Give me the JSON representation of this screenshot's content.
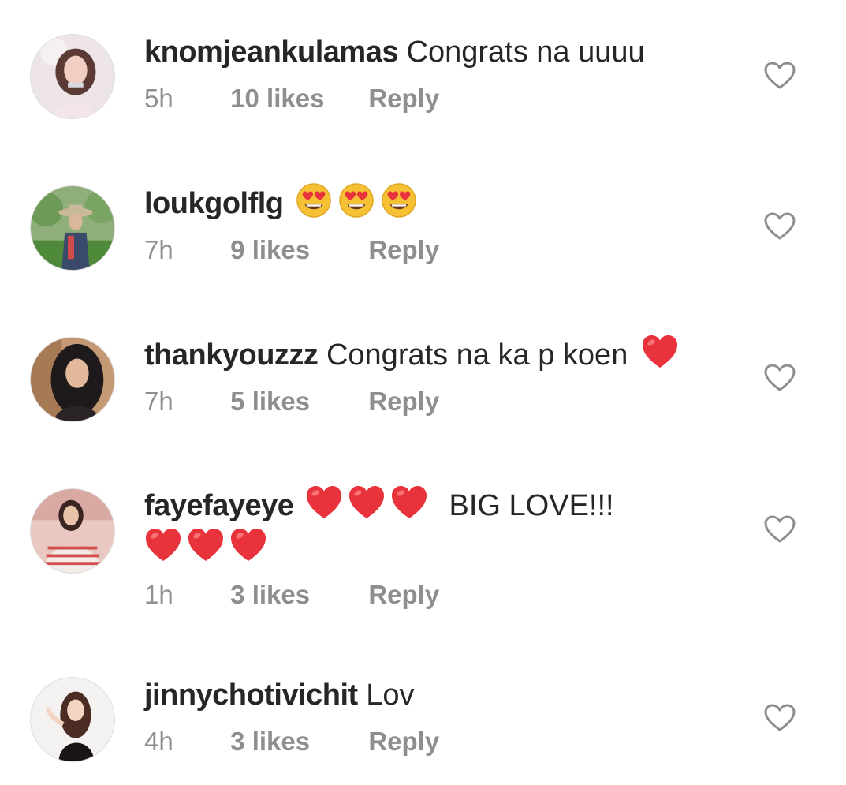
{
  "colors": {
    "text": "#262626",
    "muted": "#8e8e8e",
    "heart_red": "#e8323c",
    "emoji_yellow": "#f5c033"
  },
  "comments": [
    {
      "username": "knomjeankulamas",
      "text": "Congrats na uuuu",
      "time": "5h",
      "likes": "10 likes",
      "reply": "Reply",
      "like_icon": "heart-outline-icon"
    },
    {
      "username": "loukgolflg",
      "emoji": [
        "heart-eyes-emoji",
        "heart-eyes-emoji",
        "heart-eyes-emoji"
      ],
      "time": "7h",
      "likes": "9 likes",
      "reply": "Reply",
      "like_icon": "heart-outline-icon"
    },
    {
      "username": "thankyouzzz",
      "text": "Congrats na ka p koen",
      "emoji": [
        "red-heart-emoji"
      ],
      "time": "7h",
      "likes": "5 likes",
      "reply": "Reply",
      "like_icon": "heart-outline-icon"
    },
    {
      "username": "fayefayeye",
      "emoji": [
        "red-heart-emoji",
        "red-heart-emoji",
        "red-heart-emoji"
      ],
      "text": "BIG LOVE!!!",
      "emoji_line2": [
        "red-heart-emoji",
        "red-heart-emoji",
        "red-heart-emoji"
      ],
      "time": "1h",
      "likes": "3 likes",
      "reply": "Reply",
      "like_icon": "heart-outline-icon"
    },
    {
      "username": "jinnychotivichit",
      "text": "Lov",
      "time": "4h",
      "likes": "3 likes",
      "reply": "Reply",
      "like_icon": "heart-outline-icon"
    }
  ]
}
